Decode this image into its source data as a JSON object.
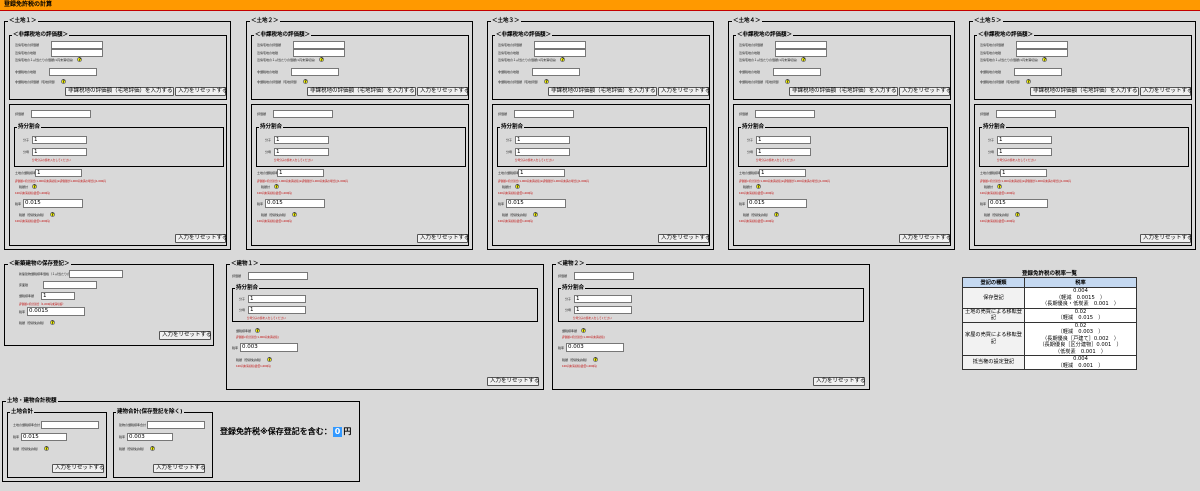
{
  "app": {
    "title": "登録免許税の計算"
  },
  "land": [
    {
      "title": "＜土地１＞"
    },
    {
      "title": "＜土地２＞"
    },
    {
      "title": "＜土地３＞"
    },
    {
      "title": "＜土地４＞"
    },
    {
      "title": "＜土地５＞"
    }
  ],
  "land_common": {
    "nontax_title": "＜非課税地の評価額＞",
    "nontax_fields": [
      "近傍宅地の評価額",
      "近傍宅地の地積",
      "近傍宅地の１㎡当たりの価額(1円未満切捨)",
      "非課税地の地積",
      "非課税地の評価額（宅地評価）"
    ],
    "nontax_apply_button": "非課税地の評価額（宅地評価）を入力する",
    "reset_button": "入力をリセットする",
    "valuation_label": "評価額",
    "share_title": "持分割合",
    "numerator_label": "分子",
    "numerator_value": "1",
    "denominator_label": "分母",
    "denominator_value": "1",
    "share_note": "分母分子の値を入力してください",
    "base_label": "土地の課税標準",
    "base_value": "1",
    "base_note": "評価額×持分割合(1,000円未満切捨)※評価額が1,000円未満の場合は1,000円",
    "tax_label": "税額計",
    "tax_note": "100円未満切捨(最低1,000円)",
    "rate_label": "税率",
    "rate_value": "0.015",
    "tax2_label": "税額（登録免許税）"
  },
  "new_building": {
    "title": "＜新築建物の保存登記＞",
    "fields": [
      "新築建物課税標準価格（１㎡当たりの価額）",
      "床面積",
      "課税標準額"
    ],
    "base_value": "1",
    "base_note": "評価額×持分割合（1,000円未満切捨）",
    "rate_label": "税率",
    "rate_value": "0.0015",
    "tax_label": "税額（登録免許税）",
    "reset_button": "入力をリセットする"
  },
  "buildings": [
    {
      "title": "＜建物１＞"
    },
    {
      "title": "＜建物２＞"
    }
  ],
  "building_common": {
    "valuation_label": "評価額",
    "share_title": "持分割合",
    "numerator_label": "分子",
    "numerator_value": "1",
    "denominator_label": "分母",
    "denominator_value": "1",
    "share_note": "分母分子の値を入力してください",
    "tax_label": "課税標準額",
    "tax_note": "評価額×持分割合(1,000円未満切捨)",
    "rate_label": "税率",
    "rate_value": "0.003",
    "tax2_label": "税額（登録免許税）",
    "tax2_note": "100円未満切捨(最低1,000円)",
    "reset_button": "入力をリセットする"
  },
  "totals": {
    "title": "土地・建物合計税額",
    "land_total": {
      "title": "土地合計",
      "base_label": "土地の課税標準合計",
      "rate_label": "税率",
      "rate_value": "0.015",
      "tax_label": "税額（登録免許税）"
    },
    "building_total": {
      "title": "建物合計(保存登記を除く)",
      "base_label": "建物の課税標準合計",
      "rate_label": "税率",
      "rate_value": "0.003",
      "tax_label": "税額（登録免許税）"
    },
    "reset_button": "入力をリセットする",
    "grand_label": "登録免許税※保存登記を含む：",
    "grand_value": "0",
    "grand_unit": "円"
  },
  "rate_table": {
    "title": "登録免許税の税率一覧",
    "headers": [
      "登記の種類",
      "税率"
    ],
    "rows": [
      {
        "kind": "保存登記",
        "lines": [
          "0.004",
          "（軽減　0.0015　）",
          "（長期優良・低炭素　0.001　）"
        ]
      },
      {
        "kind": "土地の売買による移転登記",
        "lines": [
          "0.02",
          "（軽減　0.015　）"
        ]
      },
      {
        "kind": "家屋の売買による移転登記",
        "lines": [
          "0.02",
          "（軽減　0.003　）",
          "（長期優良［戸建て］0.002　）",
          "（長期優良［区分建物］0.001　）",
          "（低炭素　0.001　）"
        ]
      },
      {
        "kind": "抵当権の設定登記",
        "lines": [
          "0.004",
          "（軽減　0.001　）"
        ]
      }
    ]
  },
  "colors": {
    "title_bar": "#ff9900",
    "highlight": "#3399ff",
    "help_icon": "#ffff00",
    "note_text": "#c00000"
  }
}
